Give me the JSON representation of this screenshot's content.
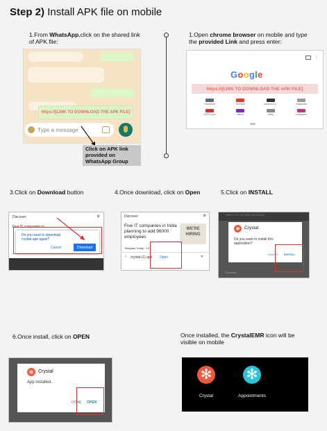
{
  "title": {
    "step": "Step 2)",
    "text": "Install APK file on mobile"
  },
  "step1": {
    "caption_pre": "1.From ",
    "caption_bold": "WhatsApp",
    "caption_post": ",click on the shared link of APK file:",
    "link_text": "https://[LINK TO DOWNLOAD THE APK FILE]",
    "input_placeholder": "Type a message",
    "tooltip": "Click on APK link provided on WhatsApp Group"
  },
  "step1b": {
    "caption_pre": "1.Open ",
    "caption_bold1": "chrome browser",
    "caption_mid": " on mobile and type the ",
    "caption_bold2": "provided Link",
    "caption_post": " and press enter:",
    "logo": "Google",
    "link_text": "https://[LINK TO DOWNLOAD THE APK FILE]",
    "shortcuts": [
      "Facebook",
      "YouTube",
      "Amazon.co...",
      "Wikipedia",
      "ESPN.com",
      "Yahoo",
      "eBay",
      "Instagram"
    ]
  },
  "step3": {
    "caption_pre": "3.Click on ",
    "caption_bold": "Download",
    "caption_post": " button",
    "discover": "Discover",
    "news": "Five IT companies in",
    "dialog_text": "Do you want to download crystal.apk again?",
    "cancel": "Cancel",
    "download": "Download"
  },
  "step4": {
    "caption_pre": "4.Once download, click on ",
    "caption_bold": "Open",
    "discover": "Discover",
    "news": "Five IT companies in India planning to add 96000 employees",
    "hiring": "WE'RE HIRING",
    "source": "Telegana Today · 1d",
    "file": "crystal (1).apk",
    "open": "Open"
  },
  "step5": {
    "caption_pre": "5.Click on ",
    "caption_bold": "INSTALL",
    "app_name": "Crystal",
    "question": "Do you want to install this application?",
    "cancel": "CANCEL",
    "install": "INSTALL",
    "top_text": "IMPACT OF THE HIRE DECISIONS",
    "bottom_text": "Discover"
  },
  "step6": {
    "caption_pre": "6.Once install, click on ",
    "caption_bold": "OPEN",
    "app_name": "Crystal",
    "status": "App installed.",
    "done": "DONE",
    "open": "OPEN"
  },
  "step7": {
    "caption_pre": "Once installed, the ",
    "caption_bold": "CrystalEMR",
    "caption_post": " icon will be visible on mobile",
    "apps": [
      "Crystal",
      "Appointments"
    ]
  },
  "colors": {
    "red": "#e03030",
    "teal": "#0e7a6a",
    "crystal_orange": "#f05a3c",
    "crystal_teal": "#2bc4d8",
    "blue": "#1a73e8"
  }
}
